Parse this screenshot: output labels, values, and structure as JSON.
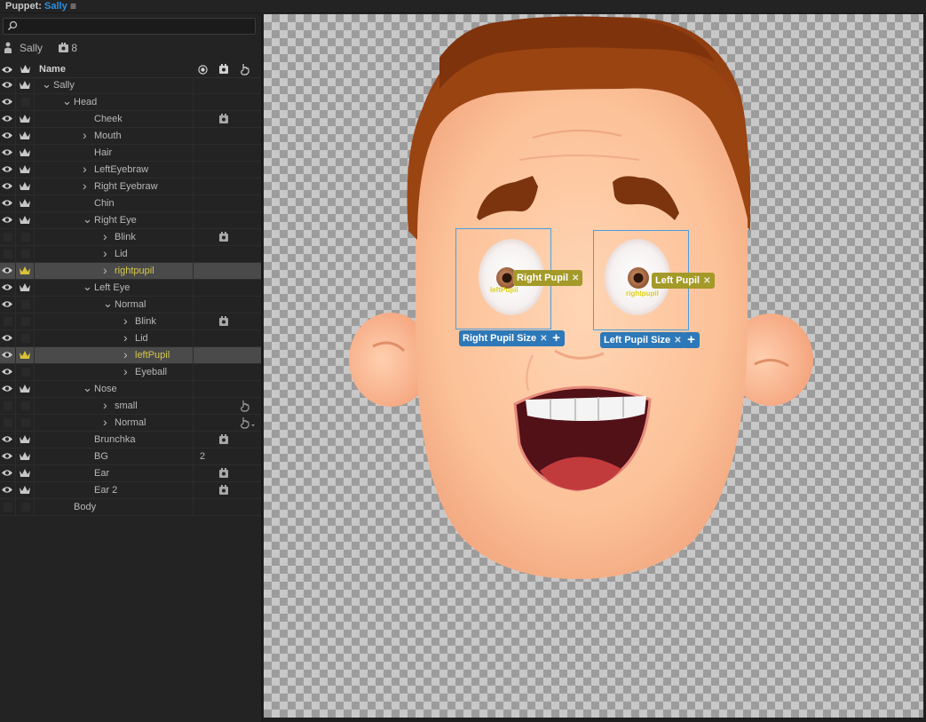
{
  "header": {
    "prefix": "Puppet:",
    "puppet_name": "Sally",
    "menu_icon": "hamburger-icon"
  },
  "search": {
    "placeholder": ""
  },
  "puppet_info": {
    "name": "Sally",
    "tag_count": "8"
  },
  "columns": {
    "name": "Name"
  },
  "rows": [
    {
      "label": "Sally"
    },
    {
      "label": "Head"
    },
    {
      "label": "Cheek"
    },
    {
      "label": "Mouth"
    },
    {
      "label": "Hair"
    },
    {
      "label": "LeftEyebraw"
    },
    {
      "label": "Right Eyebraw"
    },
    {
      "label": "Chin"
    },
    {
      "label": "Right Eye"
    },
    {
      "label": "Blink"
    },
    {
      "label": "Lid"
    },
    {
      "label": "rightpupil"
    },
    {
      "label": "Left Eye"
    },
    {
      "label": "Normal"
    },
    {
      "label": "Blink"
    },
    {
      "label": "Lid"
    },
    {
      "label": "leftPupil"
    },
    {
      "label": "Eyeball"
    },
    {
      "label": "Nose"
    },
    {
      "label": "small"
    },
    {
      "label": "Normal"
    },
    {
      "label": "Brunchka"
    },
    {
      "label": "BG",
      "value": "2"
    },
    {
      "label": "Ear"
    },
    {
      "label": "Ear 2"
    },
    {
      "label": "Body"
    }
  ],
  "canvas": {
    "right_pupil_tag": "Right Pupil",
    "left_pupil_tag": "Left Pupil",
    "right_pupil_size_tag": "Right Pupil Size",
    "left_pupil_size_tag": "Left Pupil Size",
    "right_handle_label": "leftPupil",
    "left_handle_label": "rightpupil",
    "remove_glyph": "✕",
    "add_glyph": "+"
  },
  "colors": {
    "accent": "#2f8fe0",
    "tag_blue": "#2d78b8",
    "tag_olive": "#a49a29",
    "highlight_text": "#d6c84a"
  }
}
